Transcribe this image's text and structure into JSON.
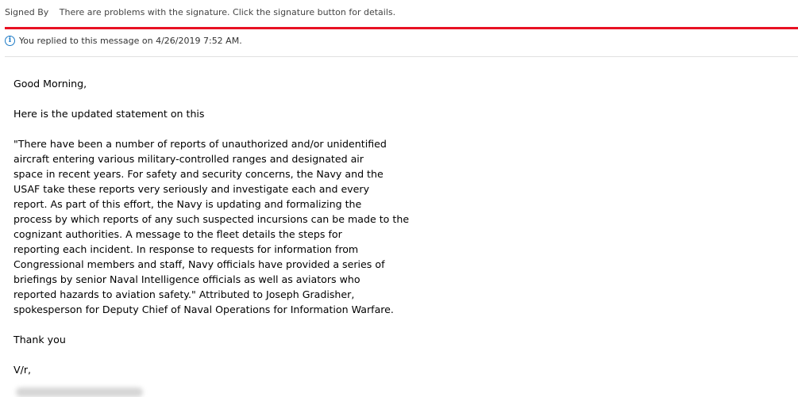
{
  "header": {
    "signed_by_label": "Signed By",
    "signature_message": "There are problems with the signature. Click the signature button for details.",
    "info_icon": "info-icon",
    "reply_notice": "You replied to this message on 4/26/2019 7:52 AM.",
    "alert_color": "#e81123",
    "info_color": "#1e7bc6"
  },
  "message": {
    "greeting": "Good Morning,",
    "intro": "Here is the updated statement on this",
    "statement_lines": [
      "\"There have been a number of reports of unauthorized and/or unidentified",
      "aircraft entering various military-controlled ranges and designated air",
      "space in recent years. For safety and security concerns, the Navy and the",
      "USAF take these reports very seriously and investigate each and every",
      "report. As part of this effort, the Navy is updating and formalizing the",
      "process by which reports of any such suspected incursions can be made to the",
      "cognizant authorities. A message to the fleet details the steps for",
      "reporting each incident. In response to requests for information from",
      "Congressional members and staff, Navy officials have provided a series of",
      "briefings by senior Naval Intelligence officials as well as aviators who",
      "reported hazards to aviation safety.\" Attributed to Joseph Gradisher,",
      "spokesperson for Deputy Chief of Naval Operations for Information Warfare."
    ],
    "closing": "Thank you",
    "signoff": "V/r,"
  }
}
